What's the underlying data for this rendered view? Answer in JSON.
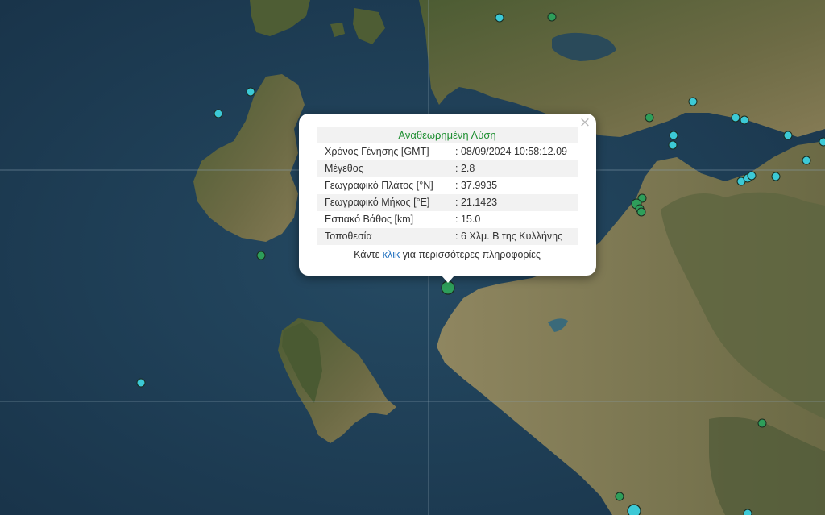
{
  "popup": {
    "title": "Αναθεωρημένη Λύση",
    "close_symbol": "×",
    "rows": [
      {
        "label": "Χρόνος Γένησης [GMT]",
        "value": ": 08/09/2024 10:58:12.09"
      },
      {
        "label": "Μέγεθος",
        "value": ": 2.8"
      },
      {
        "label": "Γεωγραφικό Πλάτος [°N]",
        "value": ": 37.9935"
      },
      {
        "label": "Γεωγραφικό Μήκος [°E]",
        "value": ": 21.1423"
      },
      {
        "label": "Εστιακό Βάθος [km]",
        "value": ": 15.0"
      },
      {
        "label": "Τοποθεσία",
        "value": ": 6 Χλμ. Β της Κυλλήνης"
      }
    ],
    "more_prefix": "Κάντε ",
    "more_link": "κλικ",
    "more_suffix": " για περισσότερες πληροφορίες"
  },
  "map": {
    "colors": {
      "sea": "#1d3a4f",
      "land": "#5c6a3c",
      "land_dark": "#3d4d2b",
      "land_light": "#8a8458",
      "marker_cyan": "#3cc9d6",
      "marker_green": "#2e9e5a",
      "marker_outline": "#1a2b1f",
      "gridline": "#8aa0b0"
    },
    "selected_marker_color": "#2e9e5a"
  }
}
